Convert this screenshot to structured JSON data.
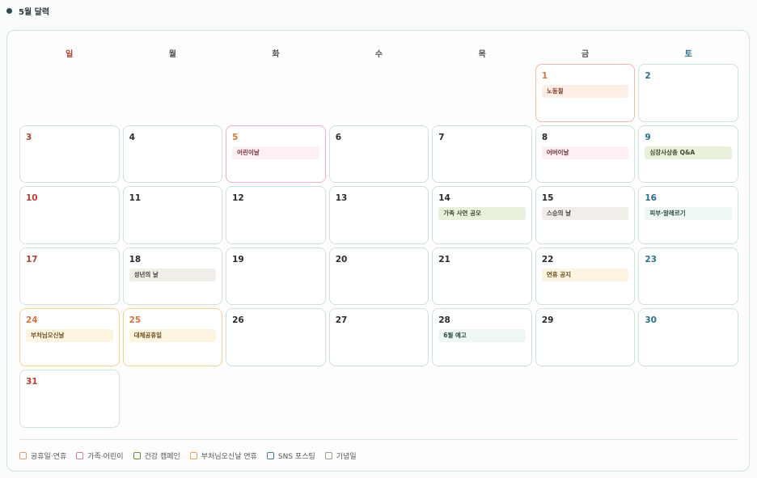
{
  "header": {
    "title": "5월 달력"
  },
  "weekdays": [
    "일",
    "월",
    "화",
    "수",
    "목",
    "금",
    "토"
  ],
  "colors": {
    "holiday": "#e8996f",
    "family": "#e07a92",
    "health": "#6b8a3e",
    "buddha": "#e3a94c",
    "sns": "#3f7f8f",
    "memorial": "#a39a8c"
  },
  "days": [
    {
      "n": "1",
      "event": "노동절",
      "cat": "holiday",
      "border": "holiday"
    },
    {
      "n": "2"
    },
    {
      "n": "3"
    },
    {
      "n": "4"
    },
    {
      "n": "5",
      "event": "어린이날",
      "cat": "family",
      "border": "family",
      "hol": true
    },
    {
      "n": "6"
    },
    {
      "n": "7"
    },
    {
      "n": "8",
      "event": "어버이날",
      "cat": "family"
    },
    {
      "n": "9",
      "event": "심장사상충 Q&A",
      "cat": "health"
    },
    {
      "n": "10"
    },
    {
      "n": "11"
    },
    {
      "n": "12"
    },
    {
      "n": "13"
    },
    {
      "n": "14",
      "event": "가족 사연 공모",
      "cat": "health"
    },
    {
      "n": "15",
      "event": "스승의 날",
      "cat": "memorial"
    },
    {
      "n": "16",
      "event": "피부·알레르기",
      "cat": "sns"
    },
    {
      "n": "17"
    },
    {
      "n": "18",
      "event": "성년의 날",
      "cat": "memorial"
    },
    {
      "n": "19"
    },
    {
      "n": "20"
    },
    {
      "n": "21"
    },
    {
      "n": "22",
      "event": "연휴 공지",
      "cat": "buddha"
    },
    {
      "n": "23"
    },
    {
      "n": "24",
      "event": "부처님오신날",
      "cat": "buddha",
      "border": "buddha",
      "hol": true
    },
    {
      "n": "25",
      "event": "대체공휴일",
      "cat": "buddha",
      "border": "buddha",
      "hol": true
    },
    {
      "n": "26"
    },
    {
      "n": "27"
    },
    {
      "n": "28",
      "event": "6월 예고",
      "cat": "sns"
    },
    {
      "n": "29"
    },
    {
      "n": "30"
    },
    {
      "n": "31"
    }
  ],
  "legend": [
    {
      "label": "공휴일·연휴",
      "cat": "holiday"
    },
    {
      "label": "가족·어린이",
      "cat": "family"
    },
    {
      "label": "건강 캠페인",
      "cat": "health"
    },
    {
      "label": "부처님오신날 연휴",
      "cat": "buddha"
    },
    {
      "label": "SNS 포스팅",
      "cat": "sns"
    },
    {
      "label": "기념일",
      "cat": "memorial"
    }
  ]
}
